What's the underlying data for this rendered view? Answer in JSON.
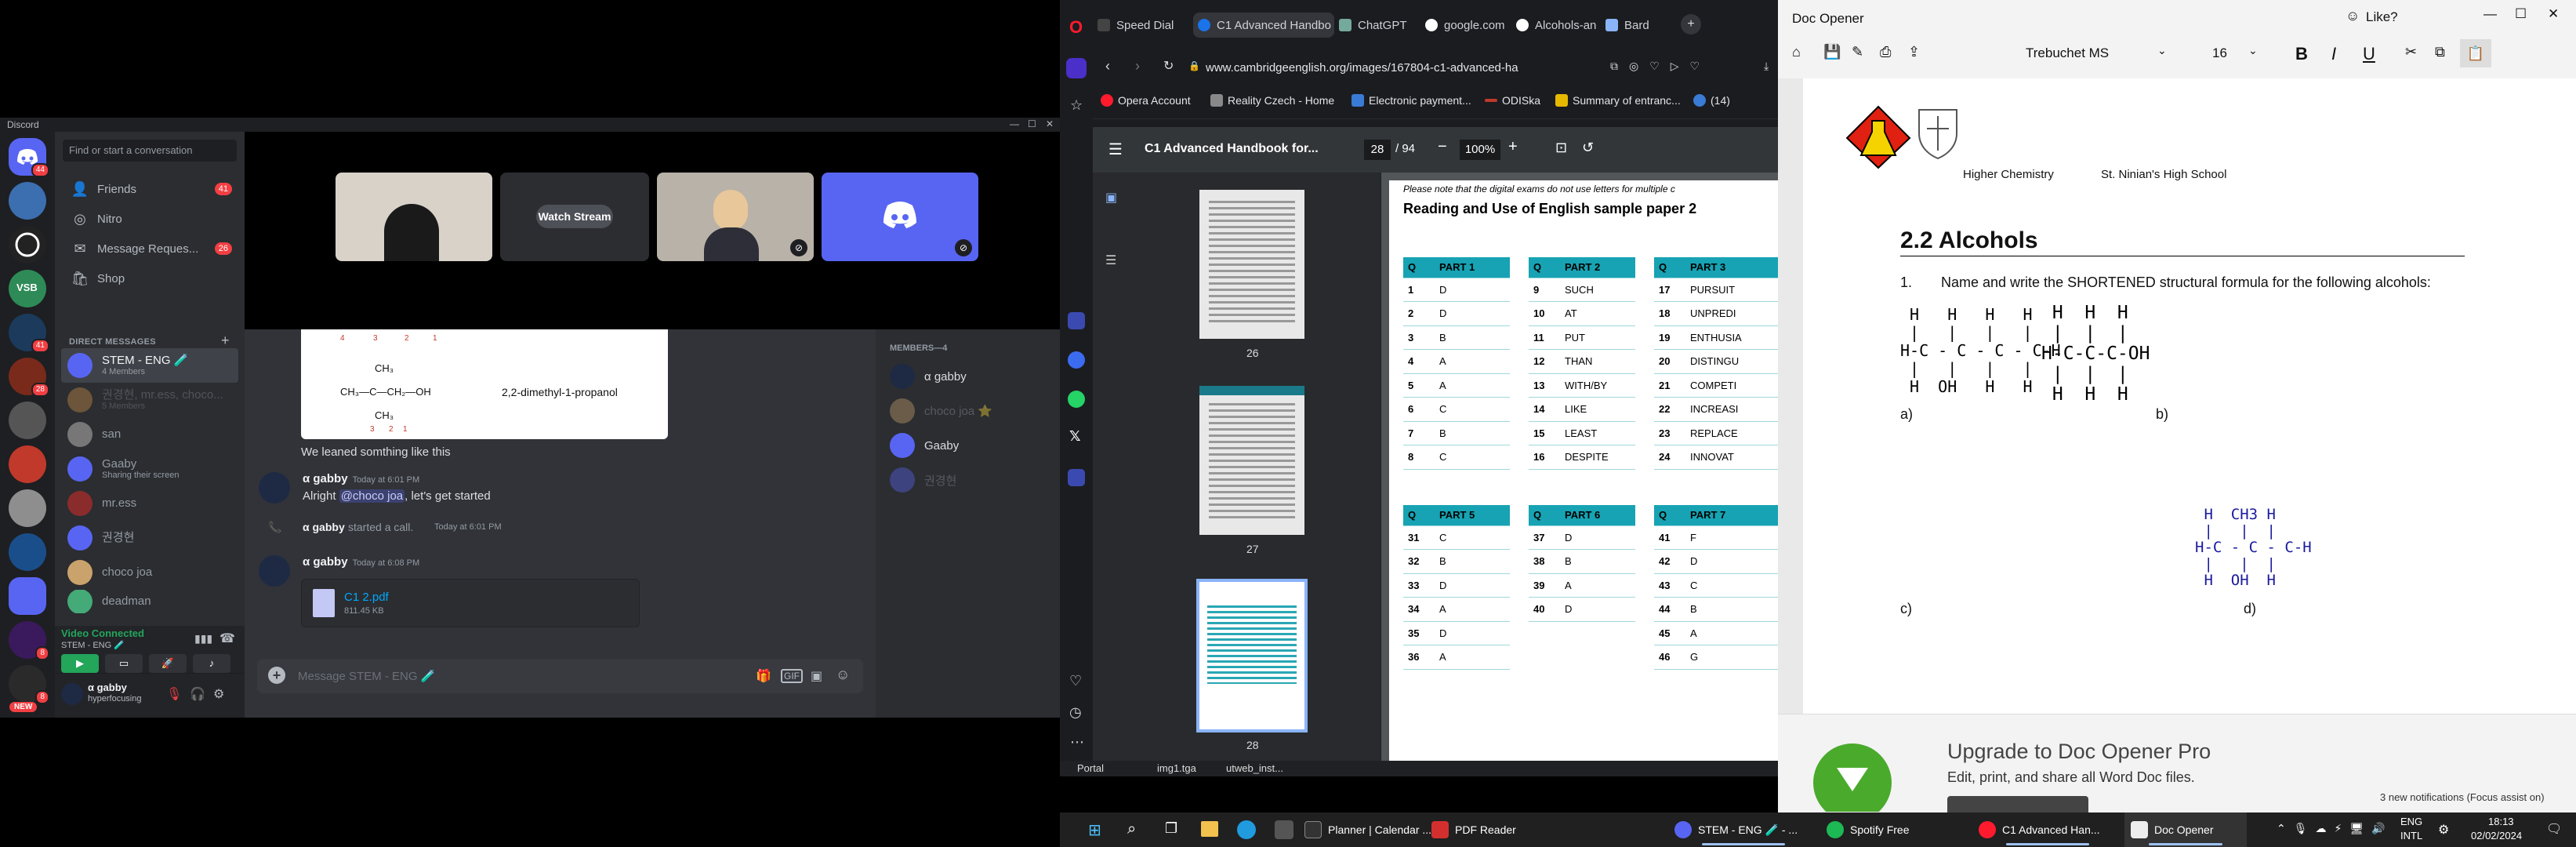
{
  "discord": {
    "app_name": "Discord",
    "search_placeholder": "Find or start a conversation",
    "nav": {
      "friends": "Friends",
      "friends_badge": "41",
      "nitro": "Nitro",
      "message_requests": "Message Reques...",
      "message_requests_badge": "26",
      "shop": "Shop"
    },
    "direct_messages_header": "DIRECT MESSAGES",
    "dms": [
      {
        "name": "STEM - ENG 🧪",
        "sub": "4 Members"
      },
      {
        "name": "권경현, mr.ess, choco...",
        "sub": "5 Members"
      },
      {
        "name": "san",
        "sub": ""
      },
      {
        "name": "Gaaby",
        "sub": "Sharing their screen"
      },
      {
        "name": "mr.ess",
        "sub": ""
      },
      {
        "name": "권경현",
        "sub": ""
      },
      {
        "name": "choco joa",
        "sub": ""
      },
      {
        "name": "deadman",
        "sub": ""
      }
    ],
    "server_badges": [
      "44",
      "41",
      "28",
      "8",
      "8"
    ],
    "server_new": "NEW",
    "voice": {
      "status": "Video Connected",
      "channel": "STEM - ENG 🧪"
    },
    "user": {
      "name": "α gabby",
      "status": "hyperfocusing"
    },
    "stream_button": "Watch Stream",
    "chat": {
      "figure": {
        "top_numbers": [
          "4",
          "3",
          "2",
          "1"
        ],
        "ch3_top": "CH₃",
        "main_chain": "CH₃—C—CH₂—OH",
        "ch3_bottom": "CH₃",
        "bottom_numbers": [
          "3",
          "2",
          "1"
        ],
        "name": "2,2-dimethyl-1-propanol"
      },
      "caption": "We leaned somthing like this",
      "messages": [
        {
          "author": "α gabby",
          "time": "Today at 6:01 PM",
          "pre": "Alright ",
          "mention": "@choco joa",
          "post": ", let's get started"
        },
        {
          "call_author": "α gabby",
          "call_text": "started a call.",
          "call_time": "Today at 6:01 PM"
        },
        {
          "author": "α gabby",
          "time": "Today at 6:08 PM"
        }
      ],
      "file": {
        "name": "C1 2.pdf",
        "size": "811.45 KB"
      },
      "input_placeholder": "Message STEM - ENG 🧪"
    },
    "members_header": "MEMBERS—4",
    "members": [
      "α gabby",
      "choco joa ⭐",
      "Gaaby",
      "권경현"
    ]
  },
  "opera": {
    "tabs": [
      "Speed Dial",
      "C1 Advanced Handbo",
      "ChatGPT",
      "google.com",
      "Alcohols-an",
      "Bard"
    ],
    "url": "www.cambridgeenglish.org/images/167804-c1-advanced-ha",
    "bookmarks": [
      "Opera Account",
      "Reality Czech - Home",
      "Electronic payment...",
      "ODISka",
      "Summary of entranc...",
      "(14)"
    ],
    "pdf": {
      "title": "C1 Advanced Handbook for...",
      "page": "28",
      "total": "/ 94",
      "zoom": "100%",
      "thumbs": [
        "26",
        "27",
        "28"
      ],
      "note": "Please note that the digital exams do not use letters for multiple c",
      "heading": "Reading and Use of English sample paper 2",
      "tables": [
        {
          "head": [
            "Q",
            "PART 1"
          ],
          "rows": [
            [
              "1",
              "D"
            ],
            [
              "2",
              "D"
            ],
            [
              "3",
              "B"
            ],
            [
              "4",
              "A"
            ],
            [
              "5",
              "A"
            ],
            [
              "6",
              "C"
            ],
            [
              "7",
              "B"
            ],
            [
              "8",
              "C"
            ]
          ]
        },
        {
          "head": [
            "Q",
            "PART 2"
          ],
          "rows": [
            [
              "9",
              "SUCH"
            ],
            [
              "10",
              "AT"
            ],
            [
              "11",
              "PUT"
            ],
            [
              "12",
              "THAN"
            ],
            [
              "13",
              "WITH/BY"
            ],
            [
              "14",
              "LIKE"
            ],
            [
              "15",
              "LEAST"
            ],
            [
              "16",
              "DESPITE"
            ]
          ]
        },
        {
          "head": [
            "Q",
            "PART 3"
          ],
          "rows": [
            [
              "17",
              "PURSUIT"
            ],
            [
              "18",
              "UNPREDI"
            ],
            [
              "19",
              "ENTHUSIA"
            ],
            [
              "20",
              "DISTINGU"
            ],
            [
              "21",
              "COMPETI"
            ],
            [
              "22",
              "INCREASI"
            ],
            [
              "23",
              "REPLACE"
            ],
            [
              "24",
              "INNOVAT"
            ]
          ]
        },
        {
          "head": [
            "Q",
            "PART 5"
          ],
          "rows": [
            [
              "31",
              "C"
            ],
            [
              "32",
              "B"
            ],
            [
              "33",
              "D"
            ],
            [
              "34",
              "A"
            ],
            [
              "35",
              "D"
            ],
            [
              "36",
              "A"
            ]
          ]
        },
        {
          "head": [
            "Q",
            "PART 6"
          ],
          "rows": [
            [
              "37",
              "D"
            ],
            [
              "38",
              "B"
            ],
            [
              "39",
              "A"
            ],
            [
              "40",
              "D"
            ]
          ]
        },
        {
          "head": [
            "Q",
            "PART 7"
          ],
          "rows": [
            [
              "41",
              "F"
            ],
            [
              "42",
              "D"
            ],
            [
              "43",
              "C"
            ],
            [
              "44",
              "B"
            ],
            [
              "45",
              "A"
            ],
            [
              "46",
              "G"
            ]
          ]
        }
      ]
    },
    "footer_items": [
      "Portal",
      "img1.tga",
      "utweb_inst..."
    ]
  },
  "doc": {
    "app_title": "Doc Opener",
    "like": "Like?",
    "font": "Trebuchet MS",
    "size": "16",
    "header_left": "Higher Chemistry",
    "header_right": "St. Ninian's High School",
    "heading": "2.2 Alcohols",
    "q_num": "1.",
    "question": "Name and write the SHORTENED structural formula for the following alcohols:",
    "labels": [
      "a)",
      "b)",
      "c)",
      "d)"
    ],
    "promo_title": "Upgrade to Doc Opener Pro",
    "promo_sub": "Edit, print, and share all Word Doc files.",
    "notifications": "3 new notifications (Focus assist on)"
  },
  "taskbar": {
    "apps": [
      "Planner | Calendar ...",
      "PDF Reader",
      "STEM - ENG 🧪 - ...",
      "Spotify Free",
      "C1 Advanced Han...",
      "Doc Opener"
    ],
    "lang": "ENG",
    "lang2": "INTL",
    "time": "18:13",
    "date": "02/02/2024"
  }
}
